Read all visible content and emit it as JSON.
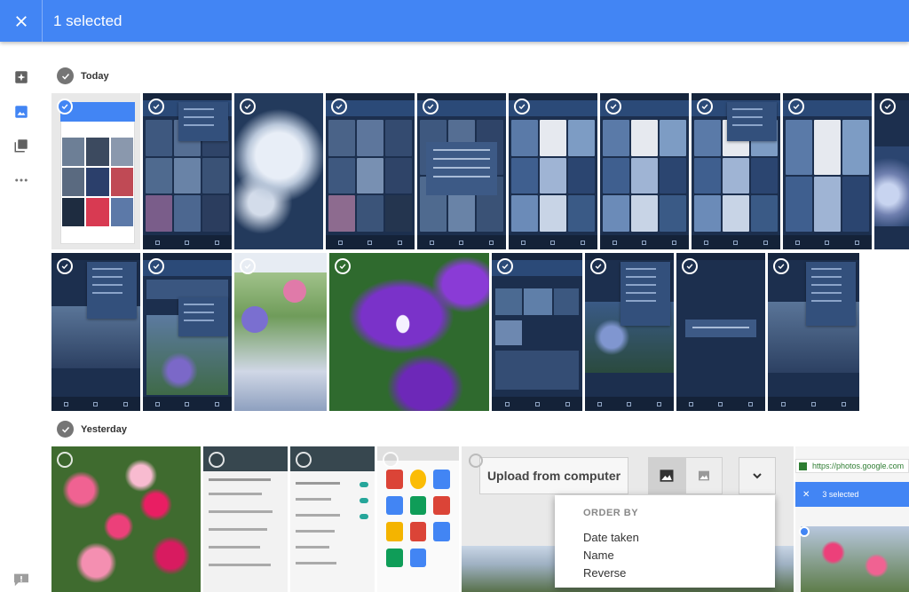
{
  "topbar": {
    "close_icon": "close-icon",
    "selection_label": "1 selected"
  },
  "rail": {
    "items": [
      "assistant-icon",
      "photos-icon",
      "albums-icon",
      "more-icon"
    ]
  },
  "sections": [
    {
      "label": "Today"
    },
    {
      "label": "Yesterday"
    }
  ],
  "colors": {
    "accent": "#4285f4",
    "phone_bg": "#1c2f4e",
    "check_grey": "#757575"
  },
  "overlay": {
    "upload_button": "Upload from computer",
    "sort_header": "ORDER BY",
    "sort_options": [
      "Date taken",
      "Name",
      "Reverse"
    ]
  },
  "browser": {
    "url": "https://photos.google.com",
    "selection_label": "3 selected"
  }
}
